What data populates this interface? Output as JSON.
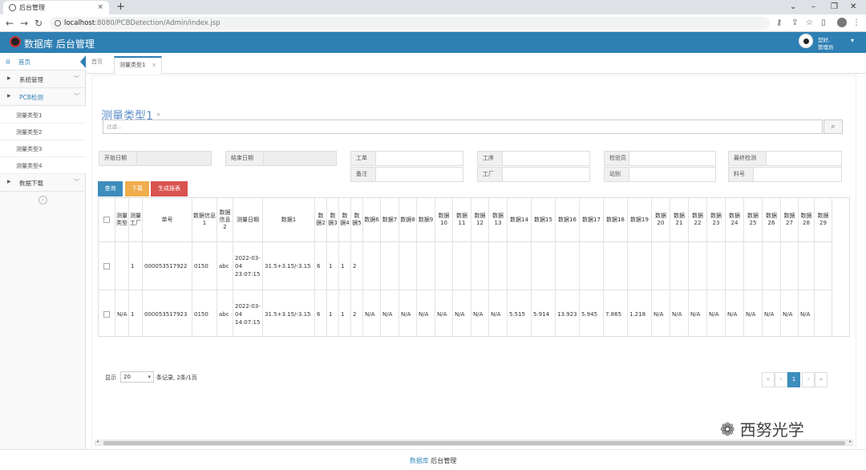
{
  "browser": {
    "tab_title": "后台管理",
    "url_host": "localhost",
    "url_path": ":8080/PCBDetection/Admin/index.jsp",
    "new_tab": "+",
    "close": "×",
    "minimize": "⌄",
    "min": "–",
    "restore": "❐",
    "win_close": "✕"
  },
  "header": {
    "title": "数据库 后台管理",
    "hello": "您好,",
    "user": "管理员"
  },
  "sidebar": {
    "home": "首页",
    "items": [
      "系统管理",
      "PCB检测",
      "数据下载"
    ],
    "sub": [
      "测量类型1",
      "测量类型2",
      "测量类型3",
      "测量类型4"
    ]
  },
  "tabs": {
    "home": "首页",
    "active": "测量类型1",
    "close": "×"
  },
  "main": {
    "title": "测量类型1",
    "search_placeholder": "过滤...",
    "filters": {
      "start_date": "开始日期",
      "end_date": "结束日期",
      "work_order": "工单",
      "process": "工序",
      "inspector": "检验员",
      "final_check": "最终检测",
      "remark": "备注",
      "factory": "工厂",
      "station": "站别",
      "material_no": "料号"
    },
    "buttons": {
      "query": "查询",
      "export": "下载",
      "report": "生成报表"
    }
  },
  "table": {
    "headers": [
      "测量类型",
      "测量工厂",
      "单号",
      "数据信息1",
      "数据信息2",
      "测量日期",
      "数据1",
      "数据2",
      "数据3",
      "数据4",
      "数据5",
      "数据6",
      "数据7",
      "数据8",
      "数据9",
      "数据10",
      "数据11",
      "数据12",
      "数据13",
      "数据14",
      "数据15",
      "数据16",
      "数据17",
      "数据18",
      "数据19",
      "数据20",
      "数据21",
      "数据22",
      "数据23",
      "数据24",
      "数据25",
      "数据26",
      "数据27",
      "数据28",
      "数据29"
    ],
    "rows": [
      [
        "",
        "1",
        "000053517922",
        "0150",
        "abc",
        "2022-03-04 23:07:15",
        "31.5+3.15/-3.15",
        "6",
        "1",
        "1",
        "2",
        "",
        "",
        "",
        "",
        "",
        "",
        "",
        "",
        "",
        "",
        "",
        "",
        "",
        "",
        "",
        "",
        "",
        "",
        "",
        "",
        "",
        "",
        "",
        ""
      ],
      [
        "N/A",
        "1",
        "000053517923",
        "0150",
        "abc",
        "2022-03-04 14:07:15",
        "31.5+3.15/-3.15",
        "6",
        "1",
        "1",
        "2",
        "N/A",
        "N/A",
        "N/A",
        "N/A",
        "N/A",
        "N/A",
        "N/A",
        "N/A",
        "5.515",
        "5.914",
        "13.923",
        "5.945",
        "7.865",
        "1.218",
        "N/A",
        "N/A",
        "N/A",
        "N/A",
        "N/A",
        "N/A",
        "N/A",
        "N/A",
        "N/A"
      ]
    ]
  },
  "pagination": {
    "show": "显示",
    "page_size": "20",
    "summary": "条记录, 2条/1页",
    "first": "«",
    "prev": "‹",
    "current": "1",
    "next": "›",
    "last": "»"
  },
  "footer": {
    "part1": "数据库",
    "part2": " 后台管理"
  },
  "watermark": "西努光学"
}
